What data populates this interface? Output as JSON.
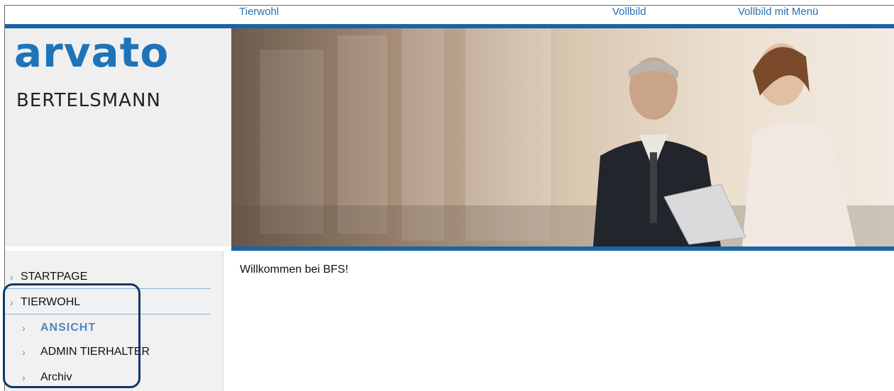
{
  "topbar": {
    "links": [
      "Tierwohl",
      "Vollbild",
      "Vollbild mit Menü"
    ]
  },
  "logo": {
    "word": "arvato",
    "sub": "BERTELSMANN"
  },
  "nav": {
    "items": [
      {
        "label": "STARTPAGE",
        "level": "top"
      },
      {
        "label": "TIERWOHL",
        "level": "top"
      },
      {
        "label": "ANSICHT",
        "level": "sub",
        "active": true
      },
      {
        "label": "ADMIN TIERHALTER",
        "level": "sub"
      },
      {
        "label": "Archiv",
        "level": "sub"
      }
    ]
  },
  "main": {
    "welcome": "Willkommen bei BFS!"
  },
  "colors": {
    "accent": "#1a63a8",
    "link": "#2a6fb0",
    "highlight": "#0f3a66"
  }
}
